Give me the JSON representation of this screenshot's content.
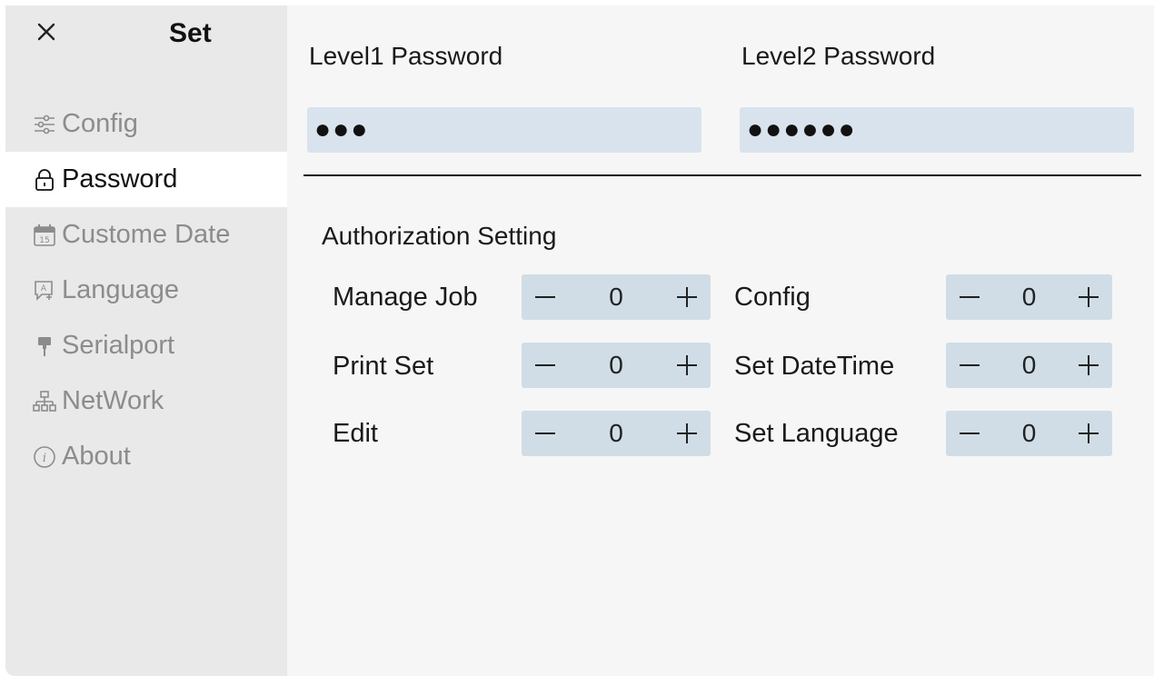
{
  "sidebar": {
    "title": "Set",
    "items": [
      {
        "label": "Config",
        "icon": "sliders-icon",
        "active": false
      },
      {
        "label": "Password",
        "icon": "lock-icon",
        "active": true
      },
      {
        "label": "Custome Date",
        "icon": "calendar-icon",
        "active": false
      },
      {
        "label": "Language",
        "icon": "language-icon",
        "active": false
      },
      {
        "label": "Serialport",
        "icon": "serialport-icon",
        "active": false
      },
      {
        "label": "NetWork",
        "icon": "network-icon",
        "active": false
      },
      {
        "label": "About",
        "icon": "info-icon",
        "active": false
      }
    ]
  },
  "passwords": {
    "level1": {
      "label": "Level1 Password",
      "value": "●●●"
    },
    "level2": {
      "label": "Level2 Password",
      "value": "●●●●●●"
    }
  },
  "authorization": {
    "title": "Authorization Setting",
    "left": [
      {
        "label": "Manage Job",
        "value": "0"
      },
      {
        "label": "Print Set",
        "value": "0"
      },
      {
        "label": "Edit",
        "value": "0"
      }
    ],
    "right": [
      {
        "label": "Config",
        "value": "0"
      },
      {
        "label": "Set DateTime",
        "value": "0"
      },
      {
        "label": "Set Language",
        "value": "0"
      }
    ]
  },
  "colors": {
    "sidebar_bg": "#e9e9e9",
    "active_bg": "#ffffff",
    "field_bg": "#d9e3ee",
    "stepper_bg": "#d0dde6"
  }
}
